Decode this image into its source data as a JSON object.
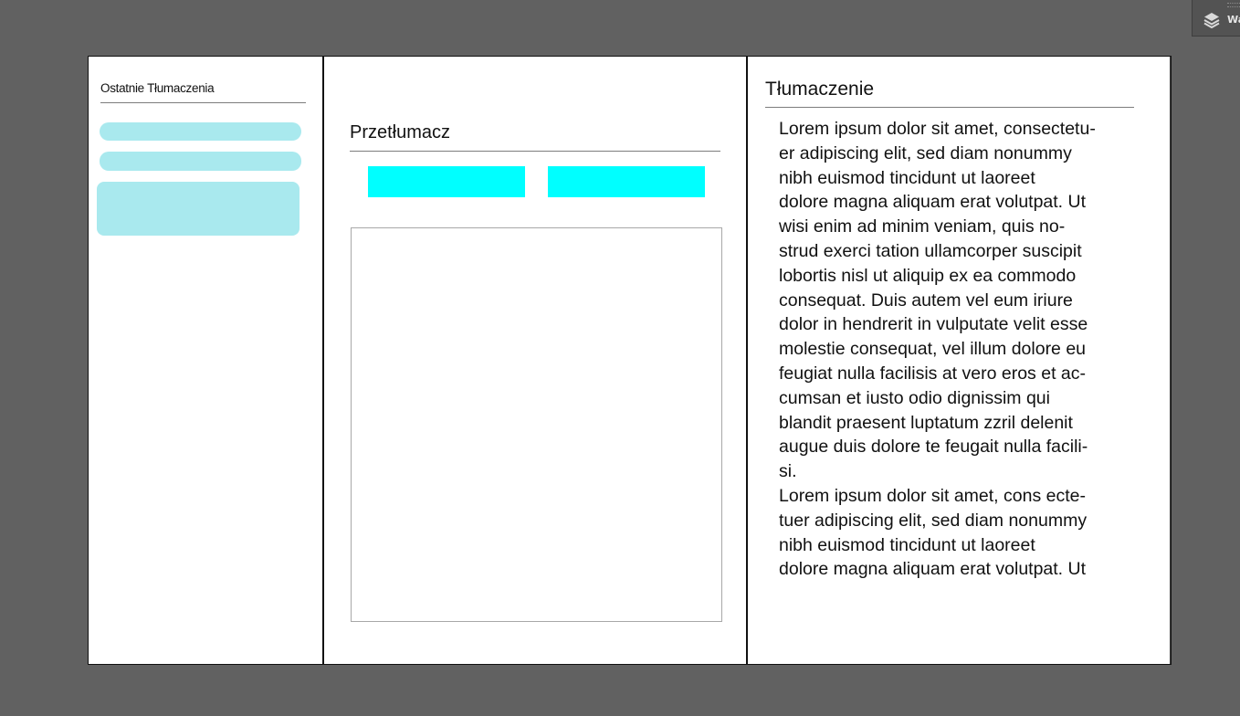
{
  "layers_tab": {
    "icon": "layers-icon",
    "label": "Wa"
  },
  "recent": {
    "title": "Ostatnie Tłumaczenia",
    "item_color": "#a9e9ee"
  },
  "translator": {
    "title": "Przetłumacz",
    "button_color": "#00ffff",
    "source_text": ""
  },
  "translation": {
    "title": "Tłumaczenie",
    "lines": [
      "Lorem ipsum dolor sit amet, consectetu-",
      "er adipiscing elit, sed diam nonummy",
      "nibh euismod tincidunt ut laoreet",
      "dolore magna aliquam erat volutpat. Ut",
      "wisi enim ad minim veniam, quis no-",
      "strud exerci tation ullamcorper suscipit",
      "lobortis nisl ut aliquip ex ea commodo",
      "consequat. Duis autem vel eum iriure",
      "dolor in hendrerit in vulputate velit esse",
      "molestie consequat, vel illum dolore eu",
      "feugiat nulla facilisis at vero eros et ac-",
      "cumsan et iusto odio dignissim qui",
      "blandit praesent luptatum zzril delenit",
      "augue duis dolore te feugait nulla facili-",
      "si.",
      "Lorem ipsum dolor sit amet, cons ecte-",
      "tuer adipiscing elit, sed diam nonummy",
      "nibh euismod tincidunt ut laoreet",
      "dolore magna aliquam erat volutpat. Ut"
    ]
  }
}
